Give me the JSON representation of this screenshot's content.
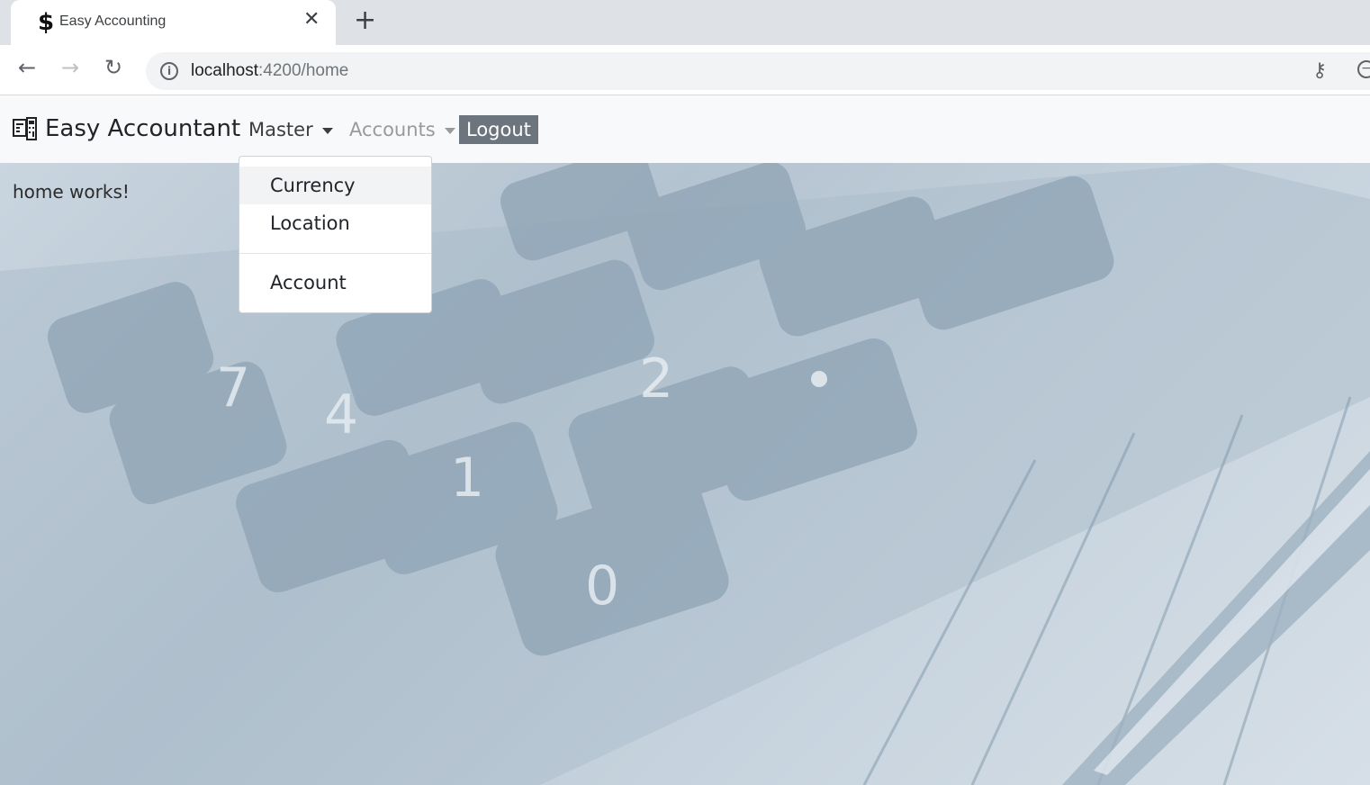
{
  "browser": {
    "tab_title": "Easy Accounting",
    "tab_favicon": "$",
    "url_host": "localhost",
    "url_path": ":4200/home"
  },
  "navbar": {
    "brand": "Easy Accountant",
    "master_label": "Master",
    "accounts_label": "Accounts",
    "logout_label": "Logout"
  },
  "dropdown": {
    "items": [
      "Currency",
      "Location",
      "Account"
    ]
  },
  "main": {
    "text": "home works!"
  },
  "colors": {
    "navbar_bg": "#f8f9fa",
    "logout_bg": "#6c757d",
    "accounts_inactive": "#9a9a9a"
  }
}
